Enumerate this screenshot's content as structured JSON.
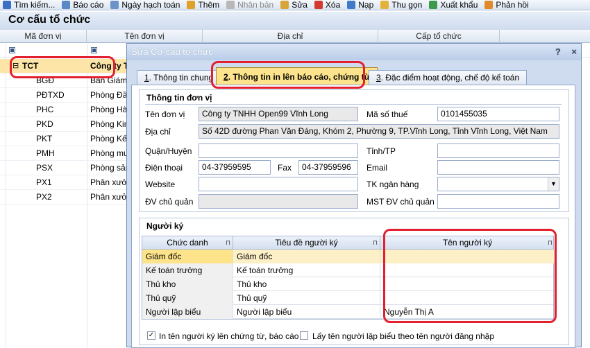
{
  "toolbar": {
    "items": [
      {
        "label": "Tìm kiếm...",
        "icon": "search-icon",
        "color": "#3a6fc4",
        "disabled": false
      },
      {
        "label": "Báo cáo",
        "icon": "report-icon",
        "color": "#5a87c5",
        "disabled": false
      },
      {
        "label": "Ngày hạch toán",
        "icon": "calendar-icon",
        "color": "#6c93c9",
        "disabled": false
      },
      {
        "label": "Thêm",
        "icon": "add-icon",
        "color": "#e0a12a",
        "disabled": false
      },
      {
        "label": "Nhân bản",
        "icon": "duplicate-icon",
        "color": "#b8b8b8",
        "disabled": true
      },
      {
        "label": "Sửa",
        "icon": "edit-icon",
        "color": "#d9a53a",
        "disabled": false
      },
      {
        "label": "Xóa",
        "icon": "delete-icon",
        "color": "#d33a2f",
        "disabled": false
      },
      {
        "label": "Nạp",
        "icon": "refresh-icon",
        "color": "#3f7ac8",
        "disabled": false
      },
      {
        "label": "Thu gọn",
        "icon": "collapse-icon",
        "color": "#e3b23c",
        "disabled": false
      },
      {
        "label": "Xuất khẩu",
        "icon": "export-icon",
        "color": "#3c9a4a",
        "disabled": false
      },
      {
        "label": "Phản hồi",
        "icon": "feedback-icon",
        "color": "#e08a2a",
        "disabled": false
      }
    ]
  },
  "page_title": "Cơ cấu tổ chức",
  "grid": {
    "headers": [
      "Mã đơn vị",
      "Tên đơn vị",
      "Địa chỉ",
      "Cấp tổ chức"
    ],
    "rows": [
      {
        "code": "TCT",
        "name": "Công ty T",
        "selected": true,
        "expander": "⊟"
      },
      {
        "code": "BGĐ",
        "name": "Ban Giám",
        "selected": false
      },
      {
        "code": "PĐTXD",
        "name": "Phòng Đầu",
        "selected": false
      },
      {
        "code": "PHC",
        "name": "Phòng Hàn",
        "selected": false
      },
      {
        "code": "PKD",
        "name": "Phòng Kinh",
        "selected": false
      },
      {
        "code": "PKT",
        "name": "Phòng Kế t",
        "selected": false
      },
      {
        "code": "PMH",
        "name": "Phòng mua",
        "selected": false
      },
      {
        "code": "PSX",
        "name": "Phòng sản",
        "selected": false
      },
      {
        "code": "PX1",
        "name": "Phân xưởn",
        "selected": false
      },
      {
        "code": "PX2",
        "name": "Phân xưởn",
        "selected": false
      }
    ]
  },
  "dialog": {
    "title": "Sửa Cơ cấu tổ chức",
    "help": "?",
    "close": "×",
    "tabs": [
      {
        "num": "1",
        "label": ". Thông tin chung"
      },
      {
        "num": "2",
        "label": ". Thông tin in lên báo cáo, chứng từ"
      },
      {
        "num": "3",
        "label": ". Đặc điểm hoạt động, chế độ kế toán"
      }
    ],
    "unit": {
      "title": "Thông tin đơn vị",
      "name_label": "Tên đơn vị",
      "name_value": "Công ty TNHH Open99 Vĩnh Long",
      "tax_label": "Mã số thuế",
      "tax_value": "0101455035",
      "address_label": "Địa chỉ",
      "address_value": "Số 42D đường Phan Văn Đáng, Khóm 2, Phường 9, TP.Vĩnh Long, Tỉnh Vĩnh Long, Việt Nam",
      "district_label": "Quận/Huyện",
      "district_value": "",
      "province_label": "Tỉnh/TP",
      "province_value": "",
      "phone_label": "Điện thoại",
      "phone_value": "04-37959595",
      "fax_label": "Fax",
      "fax_value": "04-37959596",
      "email_label": "Email",
      "email_value": "",
      "website_label": "Website",
      "website_value": "",
      "bank_label": "TK ngân hàng",
      "bank_value": "",
      "owner_label": "ĐV chủ quản",
      "owner_value": "",
      "owner_tax_label": "MST ĐV chủ quản",
      "owner_tax_value": ""
    },
    "signers": {
      "title": "Người ký",
      "headers": [
        "Chức danh",
        "Tiêu đề người ký",
        "Tên người ký"
      ],
      "rows": [
        {
          "role": "Giám đốc",
          "title": "Giám đốc",
          "name": ""
        },
        {
          "role": "Kế toán trưởng",
          "title": "Kế toán trưởng",
          "name": ""
        },
        {
          "role": "Thủ kho",
          "title": "Thủ kho",
          "name": ""
        },
        {
          "role": "Thủ quỹ",
          "title": "Thủ quỹ",
          "name": ""
        },
        {
          "role": "Người lập biểu",
          "title": "Người lập biểu",
          "name": "Nguyễn Thị A"
        }
      ],
      "print_signer_label": "In tên người ký lên chứng từ, báo cáo",
      "print_signer_checked": true,
      "use_login_label": "Lấy tên người lập biểu theo tên người đăng nhập",
      "use_login_checked": false
    }
  },
  "colors": {
    "highlight": "#e2202f",
    "selected_row": "#fce5a6",
    "active_tab": "#fde48c"
  }
}
